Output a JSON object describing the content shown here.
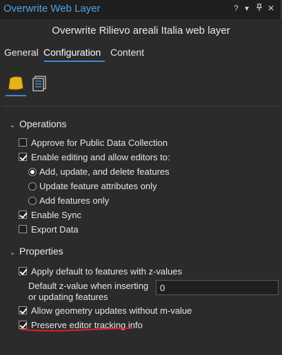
{
  "window": {
    "title": "Overwrite Web Layer",
    "buttons": {
      "options": "▾",
      "pin": "⊣",
      "close": "✕",
      "help": "?"
    }
  },
  "subtitle": "Overwrite Rilievo areali Italia web layer",
  "tabs": [
    {
      "label": "General"
    },
    {
      "label": "Configuration",
      "active": true
    },
    {
      "label": "Content"
    }
  ],
  "icon_tabs": [
    {
      "icon": "feature-layer-icon",
      "active": true
    },
    {
      "icon": "layer-properties-icon",
      "active": false
    }
  ],
  "operations": {
    "heading": "Operations",
    "approve": {
      "label": "Approve for Public Data Collection",
      "checked": false
    },
    "enable_editing": {
      "label": "Enable editing and allow editors to:",
      "checked": true
    },
    "radio_options": [
      {
        "label": "Add, update, and delete features",
        "selected": true
      },
      {
        "label": "Update feature attributes only",
        "selected": false
      },
      {
        "label": "Add features only",
        "selected": false
      }
    ],
    "enable_sync": {
      "label": "Enable Sync",
      "checked": true
    },
    "export_data": {
      "label": "Export Data",
      "checked": false
    }
  },
  "properties": {
    "heading": "Properties",
    "apply_default": {
      "label": "Apply default to features with z-values",
      "checked": true
    },
    "default_z_label": "Default z-value when inserting or updating features",
    "default_z_value": "0",
    "allow_geometry": {
      "label": "Allow geometry updates without m-value",
      "checked": true
    },
    "preserve_tracking": {
      "label": "Preserve editor tracking info",
      "checked": true
    }
  },
  "colors": {
    "accent": "#3c8bd6",
    "title": "#4fa3e6",
    "annotation": "#e0202a"
  }
}
